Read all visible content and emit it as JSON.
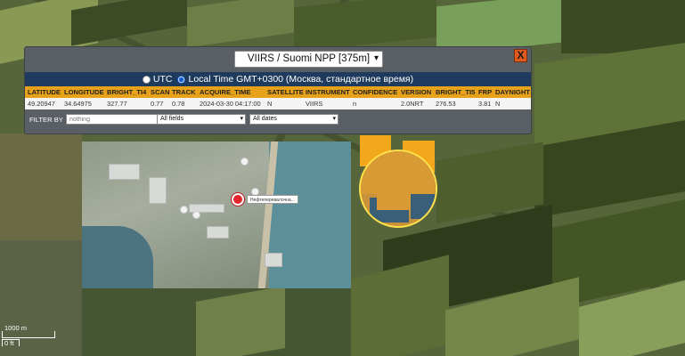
{
  "panel": {
    "source_select": "VIIRS / Suomi NPP [375m]",
    "close_label": "X",
    "time_options": {
      "utc": "UTC",
      "local": "Local Time GMT+0300 (Москва, стандартное время)"
    },
    "selected_time": "local"
  },
  "table": {
    "headers": [
      "LATITUDE",
      "LONGITUDE",
      "BRIGHT_TI4",
      "SCAN",
      "TRACK",
      "ACQUIRE_TIME",
      "SATELLITE",
      "INSTRUMENT",
      "CONFIDENCE",
      "VERSION",
      "BRIGHT_TI5",
      "FRP",
      "DAYNIGHT"
    ],
    "row": [
      "49.20947",
      "34.64975",
      "327.77",
      "0.77",
      "0.78",
      "2024-03-30 04:17:00",
      "N",
      "VIIRS",
      "n",
      "2.0NRT",
      "276.53",
      "3.81",
      "N"
    ]
  },
  "filter": {
    "label": "FILTER BY",
    "placeholder": "nothing",
    "fields_value": "All fields",
    "dates_value": "All dates"
  },
  "inset": {
    "pin_label": "Нефтеперевалочна..."
  },
  "scale": {
    "metric": "1000 m",
    "imperial": "0 ft"
  }
}
